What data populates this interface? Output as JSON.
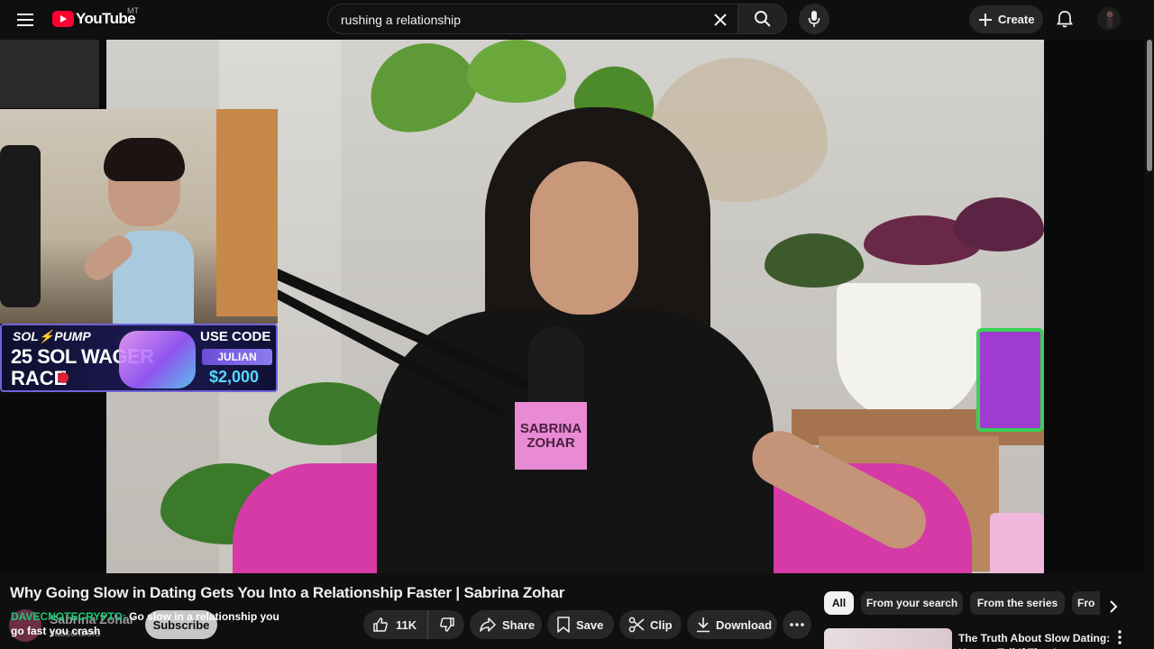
{
  "masthead": {
    "logo_text": "YouTube",
    "country_code": "MT",
    "search_value": "rushing a relationship",
    "create_label": "Create"
  },
  "video": {
    "mic_flag_line1": "SABRINA",
    "mic_flag_line2": "ZOHAR",
    "promo": {
      "brand": "SOL⚡PUMP",
      "line1": "25 SOL WAGER",
      "line2": "RACE",
      "use_code": "USE CODE",
      "code": "JULIAN",
      "amount": "$2,000"
    }
  },
  "watch": {
    "title": "Why Going Slow in Dating Gets You Into a Relationship Faster | Sabrina Zohar",
    "channel_name": "Sabrina Zohar",
    "subscribers": "subscribers",
    "subscribe_label": "Subscribe",
    "chat_user": "DAVECNOTECRYPTO:",
    "chat_message": "Go slow in a relationship you go fast you crash",
    "like_count": "11K",
    "share_label": "Share",
    "save_label": "Save",
    "clip_label": "Clip",
    "download_label": "Download"
  },
  "sidebar": {
    "chips": [
      {
        "label": "All"
      },
      {
        "label": "From your search"
      },
      {
        "label": "From the series"
      },
      {
        "label": "Fro"
      }
    ],
    "recommendation": {
      "title": "The Truth About Slow Dating: How to Tell If They're Actually..."
    }
  },
  "colors": {
    "background": "#0f0f0f",
    "brand_red": "#ff0033",
    "pill_bg": "#272727",
    "chat_user": "#18c87a"
  }
}
